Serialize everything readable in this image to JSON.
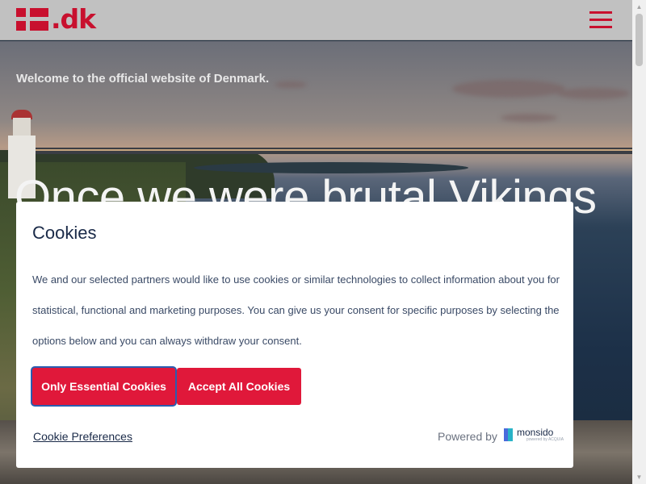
{
  "header": {
    "logo_text": ".dk",
    "brand_color": "#c8102e"
  },
  "hero": {
    "welcome": "Welcome to the official website of Denmark.",
    "headline": "Once we were brutal Vikings"
  },
  "cookie_dialog": {
    "title": "Cookies",
    "body": "We and our selected partners would like to use cookies or similar technologies to collect information about you for statistical, functional and marketing purposes. You can give us your consent for specific purposes by selecting the options below and you can always withdraw your consent.",
    "buttons": {
      "essential": "Only Essential Cookies",
      "accept_all": "Accept All Cookies"
    },
    "preferences_link": "Cookie Preferences",
    "powered_by": "Powered by",
    "vendor": "monsido",
    "vendor_sub": "powered by ACQUIA",
    "button_color": "#e0183a"
  },
  "icons": {
    "menu": "hamburger-menu-icon",
    "flag": "danish-flag-icon",
    "scroll_up": "scroll-up-arrow-icon",
    "scroll_down": "scroll-down-arrow-icon"
  }
}
